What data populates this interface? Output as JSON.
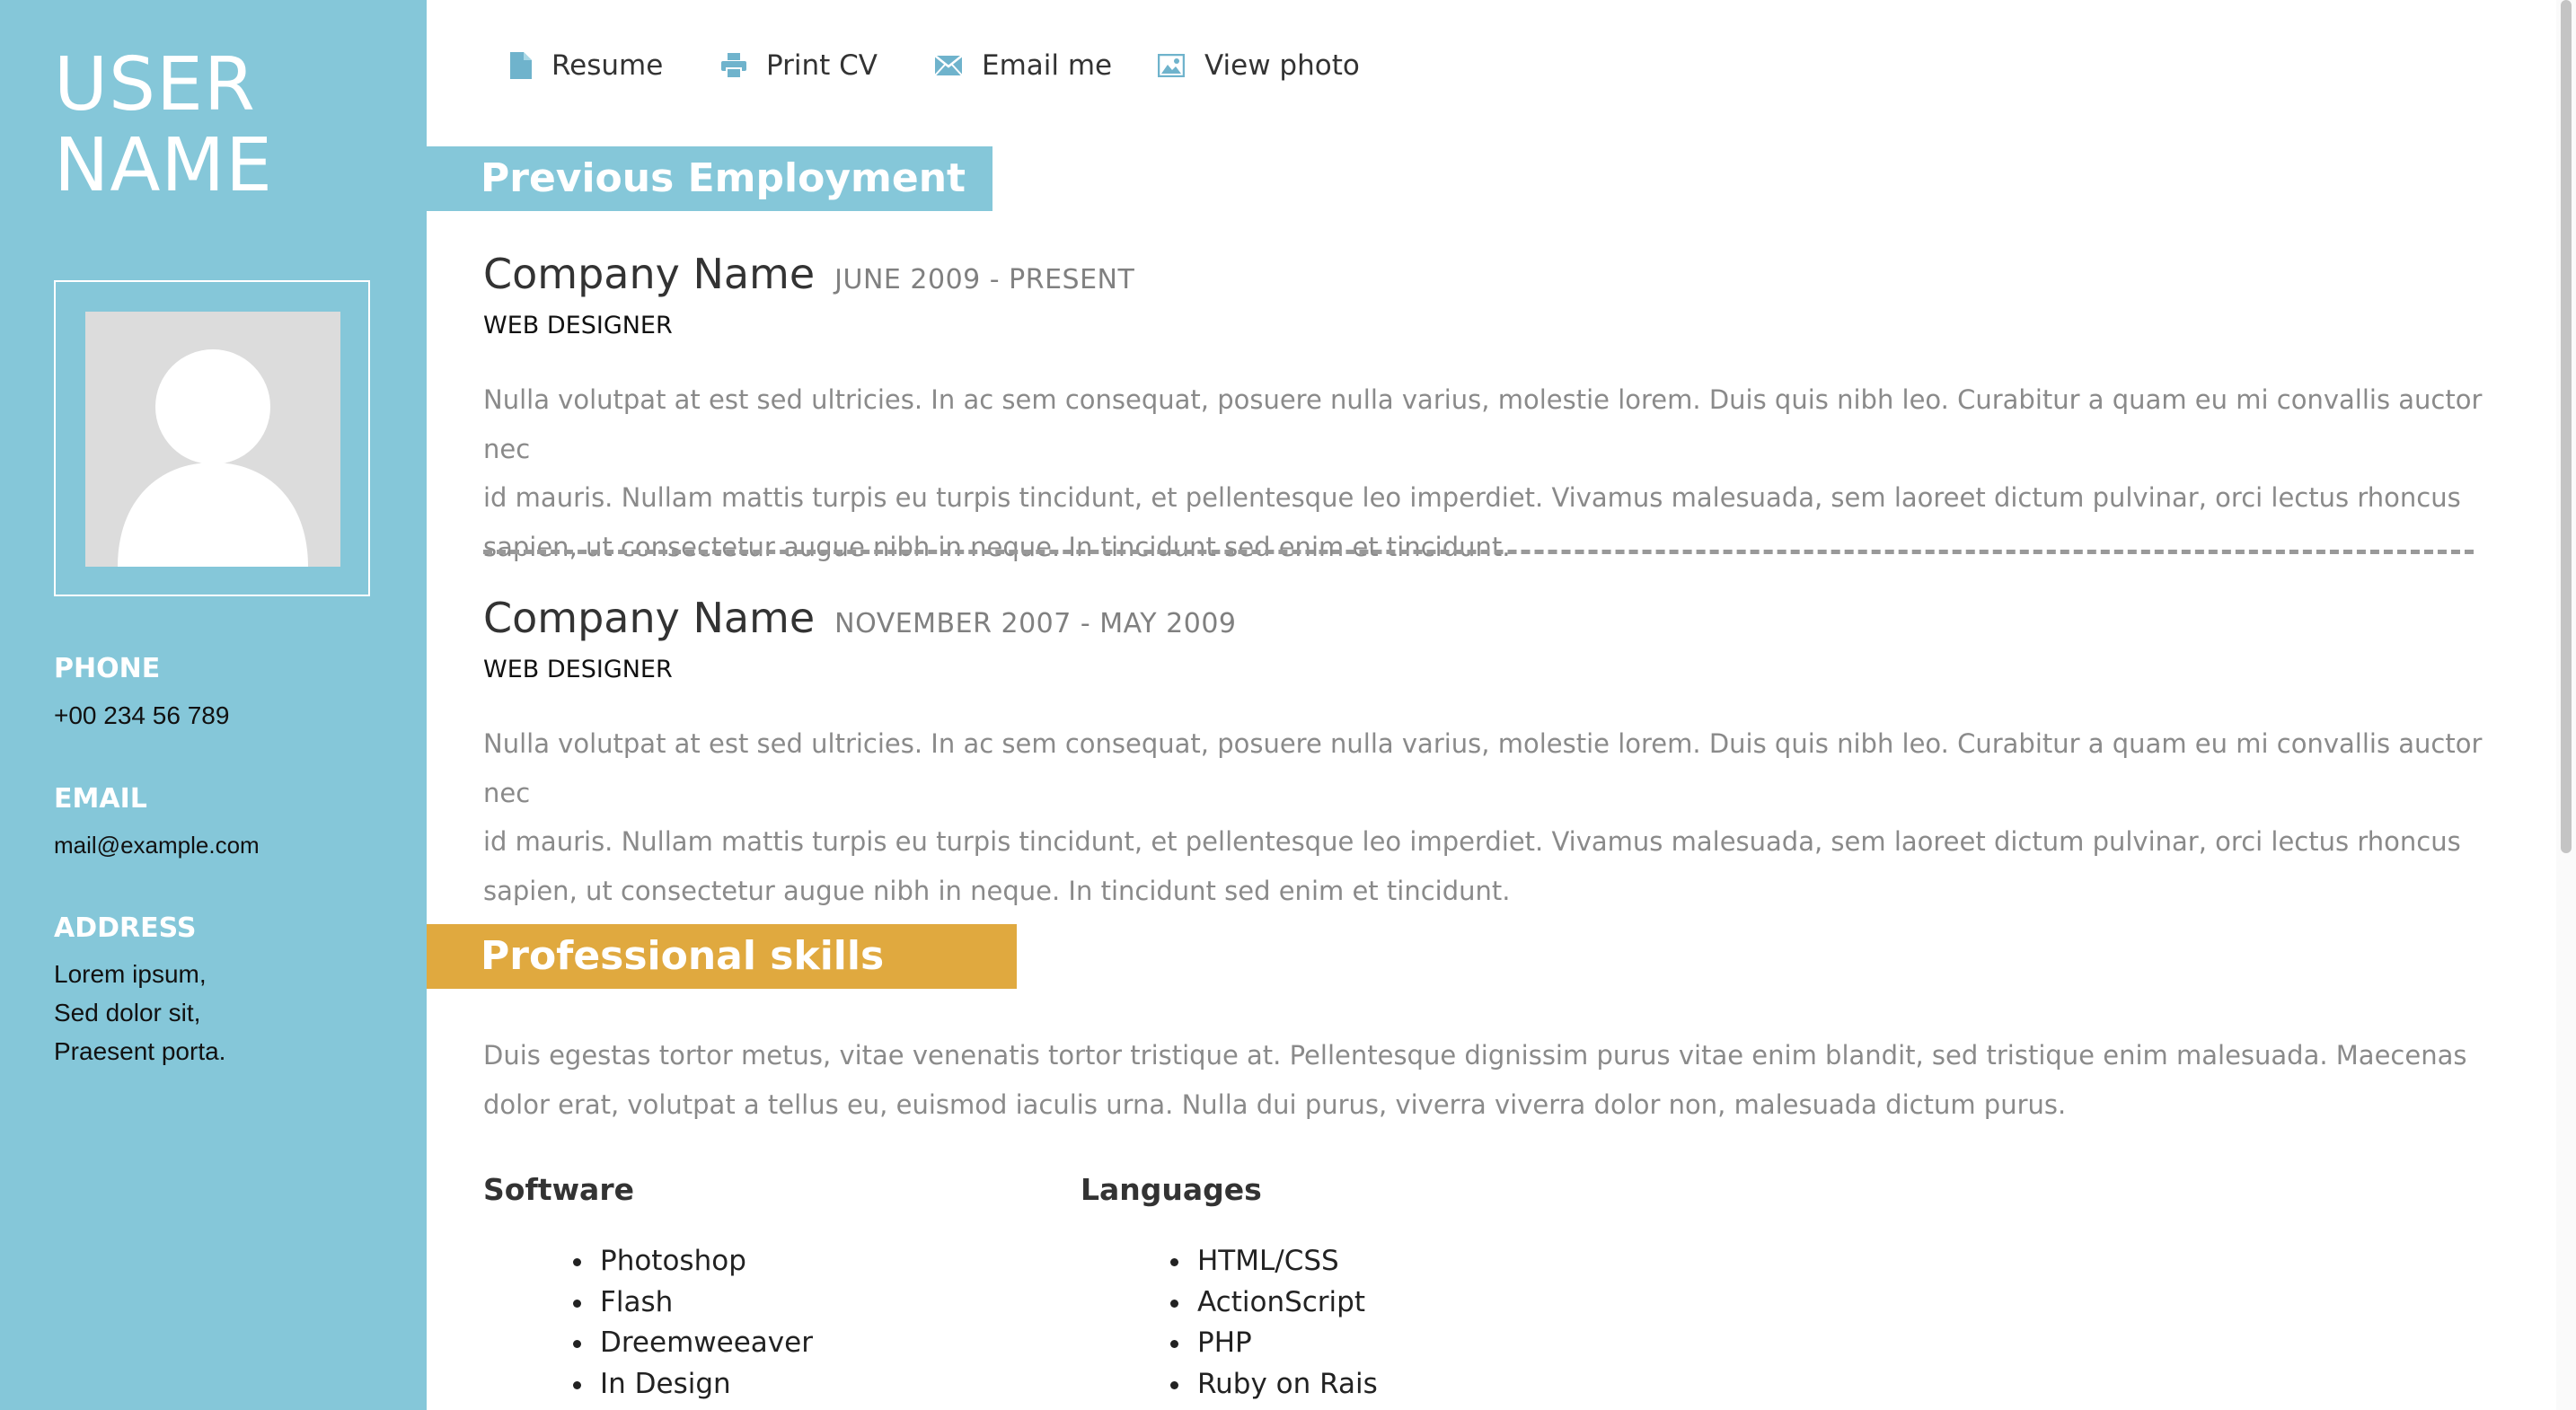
{
  "sidebar": {
    "name_line1": "USER",
    "name_line2": "NAME",
    "photo_icon": "user-placeholder-icon",
    "phone_label": "PHONE",
    "phone_value": "+00 234 56 789",
    "email_label": "EMAIL",
    "email_value": "mail@example.com",
    "address_label": "ADDRESS",
    "address_lines": [
      "Lorem ipsum,",
      "Sed dolor sit,",
      "Praesent porta."
    ]
  },
  "nav": {
    "items": [
      {
        "label": "Resume",
        "icon": "document-icon"
      },
      {
        "label": "Print CV",
        "icon": "printer-icon"
      },
      {
        "label": "Email me",
        "icon": "envelope-icon"
      },
      {
        "label": "View photo",
        "icon": "image-icon"
      }
    ]
  },
  "employment": {
    "heading": "Previous Employment",
    "jobs": [
      {
        "company": "Company Name",
        "dates": "JUNE 2009 - PRESENT",
        "role": "WEB DESIGNER",
        "lines": [
          "Nulla volutpat at est sed ultricies. In ac sem consequat, posuere nulla varius, molestie lorem. Duis quis nibh leo. Curabitur a quam eu mi convallis auctor nec",
          "id mauris. Nullam mattis turpis eu turpis tincidunt, et pellentesque leo imperdiet. Vivamus malesuada, sem laoreet dictum pulvinar, orci lectus rhoncus",
          "sapien, ut consectetur augue nibh in neque. In tincidunt sed enim et tincidunt."
        ]
      },
      {
        "company": "Company Name",
        "dates": "NOVEMBER 2007 - MAY 2009",
        "role": "WEB DESIGNER",
        "lines": [
          "Nulla volutpat at est sed ultricies. In ac sem consequat, posuere nulla varius, molestie lorem. Duis quis nibh leo. Curabitur a quam eu mi convallis auctor nec",
          "id mauris. Nullam mattis turpis eu turpis tincidunt, et pellentesque leo imperdiet. Vivamus malesuada, sem laoreet dictum pulvinar, orci lectus rhoncus",
          "sapien, ut consectetur augue nibh in neque. In tincidunt sed enim et tincidunt."
        ]
      }
    ]
  },
  "skills": {
    "heading": "Professional skills",
    "lines": [
      "Duis egestas tortor metus, vitae venenatis tortor tristique at. Pellentesque dignissim purus vitae enim blandit, sed tristique enim malesuada. Maecenas",
      "dolor erat, volutpat a tellus eu, euismod iaculis urna. Nulla dui purus, viverra viverra dolor non, malesuada dictum purus."
    ],
    "software_title": "Software",
    "software": [
      "Photoshop",
      "Flash",
      "Dreemweeaver",
      "In Design"
    ],
    "languages_title": "Languages",
    "languages": [
      "HTML/CSS",
      "ActionScript",
      "PHP",
      "Ruby on Rais"
    ]
  },
  "colors": {
    "sidebar": "#85c7d9",
    "employment_header": "#85c7d9",
    "skills_header": "#e0a93f",
    "icon_blue": "#6fb3cc"
  }
}
